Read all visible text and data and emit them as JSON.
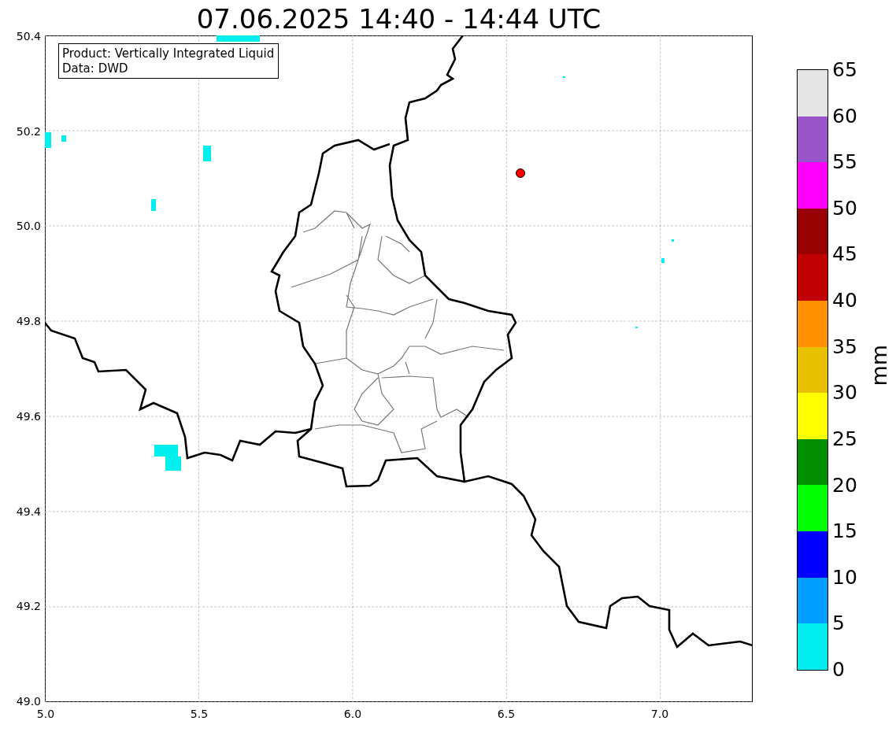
{
  "title": "07.06.2025 14:40 - 14:44 UTC",
  "info_box": [
    "Product: Vertically Integrated Liquid",
    "Data: DWD"
  ],
  "map": {
    "x_ticks": [
      "5.0",
      "5.5",
      "6.0",
      "6.5",
      "7.0"
    ],
    "y_ticks": [
      "50.4",
      "50.2",
      "50.0",
      "49.8",
      "49.6",
      "49.4",
      "49.2",
      "49.0"
    ]
  },
  "colorbar": {
    "label": "mm",
    "ticks": [
      "65",
      "60",
      "55",
      "50",
      "45",
      "40",
      "35",
      "30",
      "25",
      "20",
      "15",
      "10",
      "5",
      "0"
    ],
    "bins": [
      {
        "color": "#e4e4e4"
      },
      {
        "color": "#9955c9"
      },
      {
        "color": "#ff00ff"
      },
      {
        "color": "#990000"
      },
      {
        "color": "#c00000"
      },
      {
        "color": "#ff8f00"
      },
      {
        "color": "#e7c000"
      },
      {
        "color": "#ffff00"
      },
      {
        "color": "#008f00"
      },
      {
        "color": "#00ff00"
      },
      {
        "color": "#0000ff"
      },
      {
        "color": "#009fff"
      },
      {
        "color": "#00eeee"
      }
    ]
  }
}
